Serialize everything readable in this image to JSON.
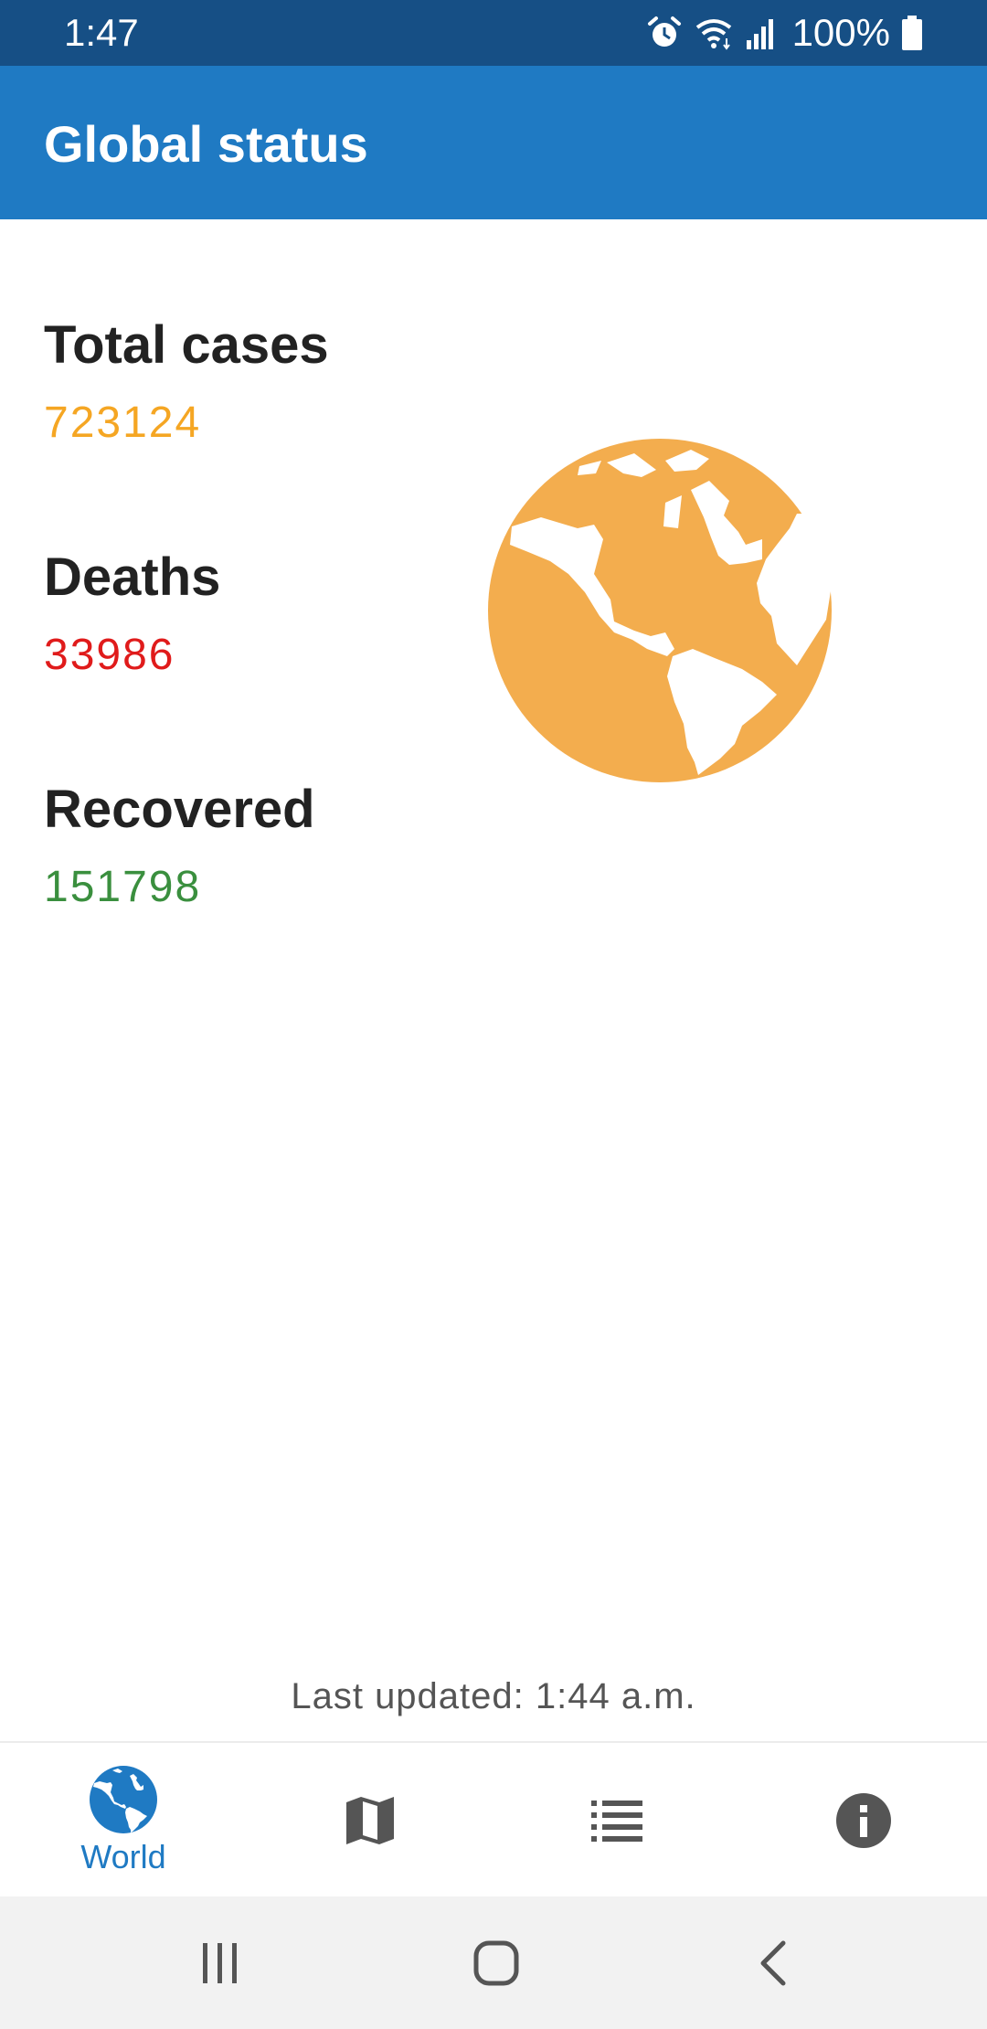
{
  "status_bar": {
    "time": "1:47",
    "battery": "100%",
    "icons": [
      "alarm-icon",
      "wifi-icon",
      "signal-icon",
      "battery-icon"
    ]
  },
  "app_bar": {
    "title": "Global status"
  },
  "stats": {
    "total": {
      "label": "Total cases",
      "value": "723124",
      "color": "#f5a623"
    },
    "deaths": {
      "label": "Deaths",
      "value": "33986",
      "color": "#e01b1b"
    },
    "recovered": {
      "label": "Recovered",
      "value": "151798",
      "color": "#3a8f3e"
    }
  },
  "globe_color": "#f3ad4e",
  "last_updated": "Last updated: 1:44 a.m.",
  "bottom_nav": {
    "items": [
      {
        "label": "World",
        "icon": "globe-icon",
        "active": true
      },
      {
        "icon": "map-icon"
      },
      {
        "icon": "list-icon"
      },
      {
        "icon": "info-icon"
      }
    ],
    "active_color": "#1f7ac3",
    "inactive_color": "#555555"
  },
  "system_nav": {
    "icons": [
      "recent-apps-icon",
      "home-icon",
      "back-icon"
    ]
  }
}
